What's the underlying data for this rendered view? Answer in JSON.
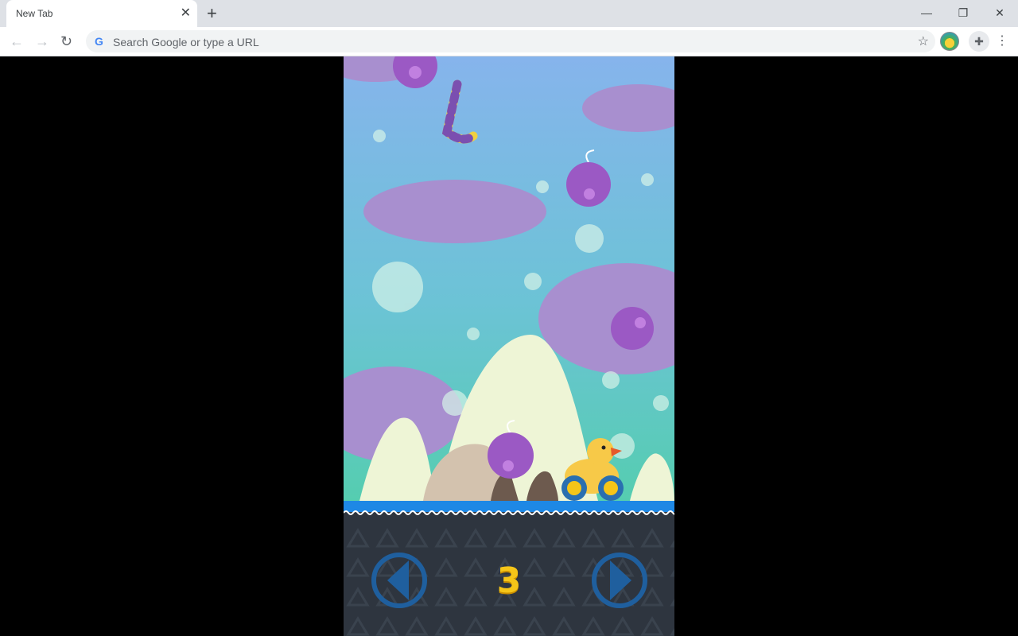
{
  "browser": {
    "tab_title": "New Tab",
    "new_tab_icon": "plus-icon",
    "omnibox_placeholder": "Search Google or type a URL",
    "window_controls": [
      "minimize",
      "restore",
      "close"
    ]
  },
  "game": {
    "score": "3",
    "colors": {
      "sky_top": "#86b4ec",
      "sky_bottom": "#55cdb0",
      "ground_strip": "#1e88e5",
      "panel": "#2e353f",
      "bomb": "#9b59c4",
      "duck": "#f7c948",
      "score": "#f5c518",
      "control": "#1f5f9e"
    },
    "controls": {
      "left": "left-arrow-button",
      "right": "right-arrow-button"
    }
  }
}
